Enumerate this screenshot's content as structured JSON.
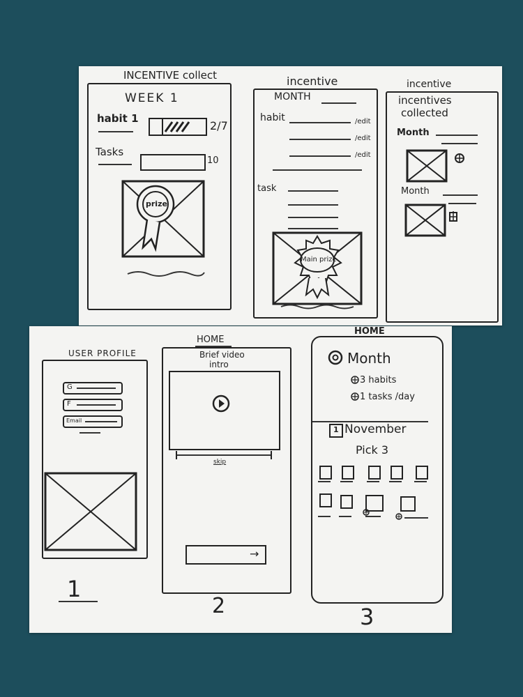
{
  "top_sheet": {
    "screen_a": {
      "title": "INCENTIVE collect",
      "week": "WEEK 1",
      "habit_label": "habit 1",
      "habit_count": "2/7",
      "tasks_label": "Tasks",
      "tasks_count": "10",
      "prize_label": "prize"
    },
    "screen_b": {
      "title": "incentive",
      "month": "MONTH",
      "habit_label": "habit",
      "edit_labels": [
        "/edit",
        "/edit",
        "/edit"
      ],
      "task_label": "task",
      "prize_label": "Main prize"
    },
    "screen_c": {
      "title": "incentive",
      "heading_line1": "incentives",
      "heading_line2": "collected",
      "month_1": "Month",
      "month_2": "Month"
    }
  },
  "bottom_sheet": {
    "screen_1": {
      "title": "USER PROFILE",
      "fields": [
        "G",
        "F",
        "Email"
      ],
      "number": "1"
    },
    "screen_2": {
      "title": "HOME",
      "subtitle_line1": "Brief video",
      "subtitle_line2": "intro",
      "skip": "skip",
      "arrow": "→",
      "number": "2"
    },
    "screen_3": {
      "title": "HOME",
      "month": "Month",
      "habits": "3 habits",
      "tasks": "1 tasks /day",
      "calendar_badge": "1",
      "november": "November",
      "pick": "Pick 3",
      "number": "3"
    }
  },
  "icons": [
    "photo-placeholder-icon",
    "prize-ribbon-icon",
    "play-icon",
    "plus-icon",
    "target-icon",
    "calendar-icon",
    "arrow-right-icon"
  ]
}
